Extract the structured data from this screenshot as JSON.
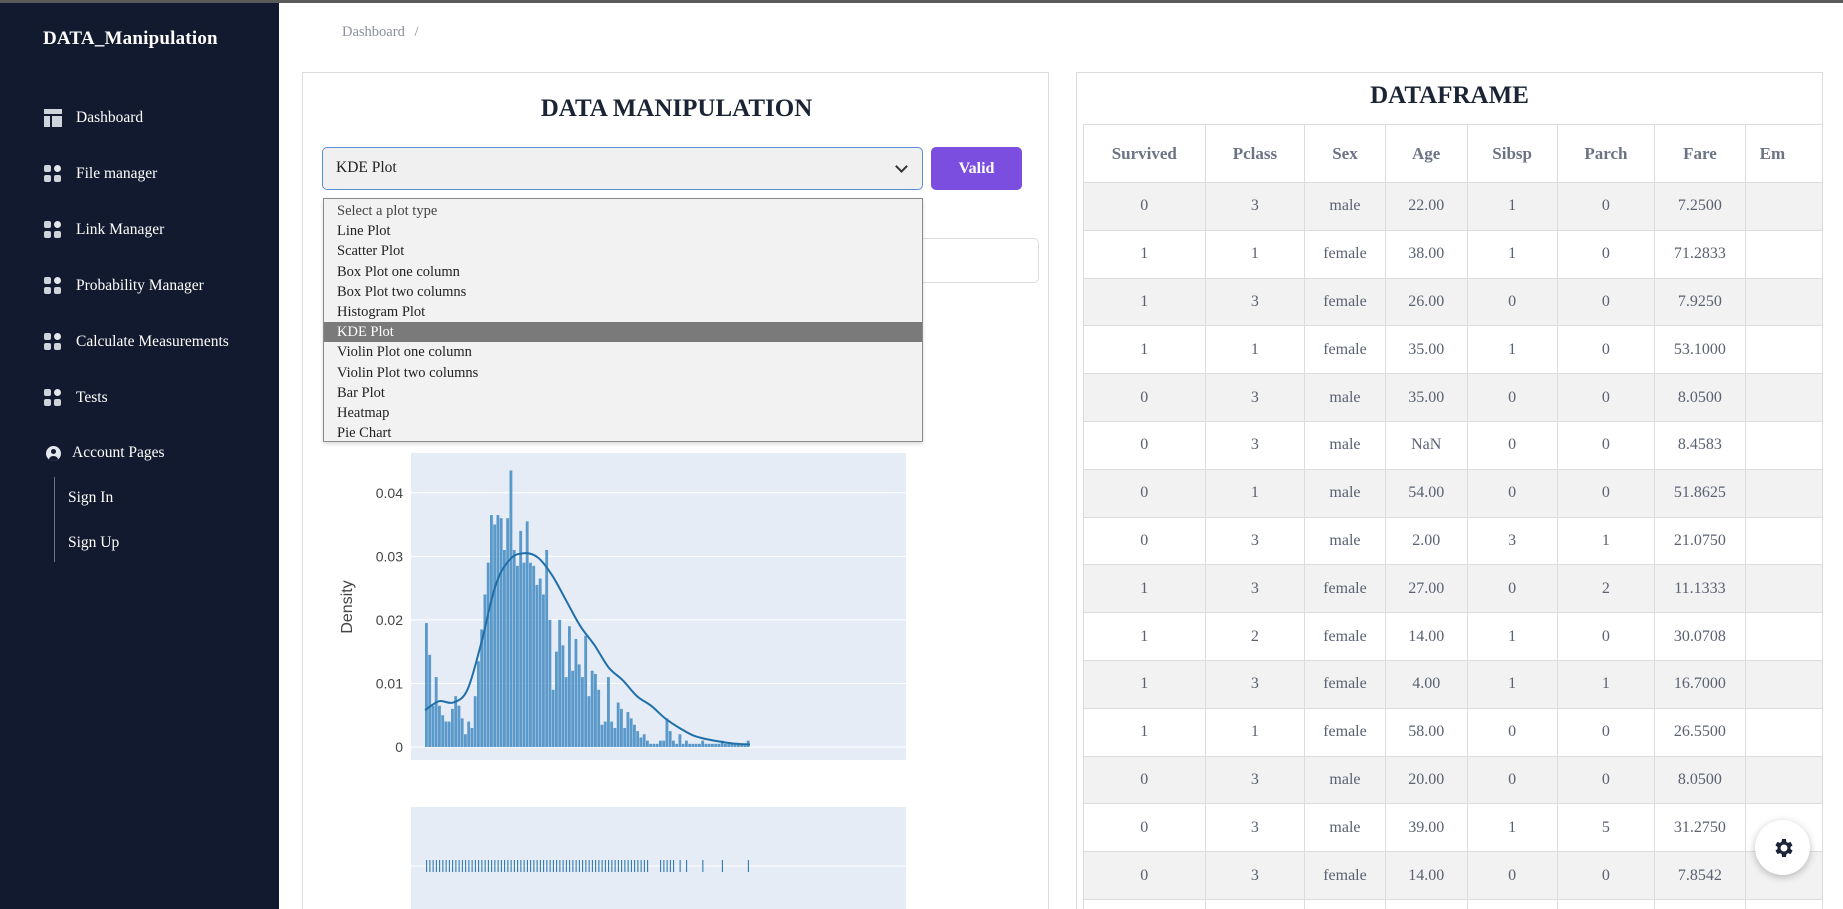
{
  "sidebar": {
    "brand": "DATA_Manipulation",
    "items": [
      {
        "label": "Dashboard",
        "icon": "dashboard-icon"
      },
      {
        "label": "File manager",
        "icon": "grid-icon"
      },
      {
        "label": "Link Manager",
        "icon": "grid-icon"
      },
      {
        "label": "Probability Manager",
        "icon": "grid-icon"
      },
      {
        "label": "Calculate Measurements",
        "icon": "grid-icon"
      },
      {
        "label": "Tests",
        "icon": "grid-icon"
      }
    ],
    "account": {
      "label": "Account Pages",
      "icon": "user-circle-icon",
      "sub": [
        "Sign In",
        "Sign Up"
      ]
    }
  },
  "breadcrumb": {
    "text": "Dashboard",
    "separator": "/"
  },
  "manipulation": {
    "title": "DATA MANIPULATION",
    "selected": "KDE Plot",
    "valid_label": "Valid",
    "options": [
      "Select a plot type",
      "Line Plot",
      "Scatter Plot",
      "Box Plot one column",
      "Box Plot two columns",
      "Histogram Plot",
      "KDE Plot",
      "Violin Plot one column",
      "Violin Plot two columns",
      "Bar Plot",
      "Heatmap",
      "Pie Chart"
    ]
  },
  "chart_data": {
    "type": "bar",
    "ylabel": "Density",
    "yticks": [
      "0",
      "0.01",
      "0.02",
      "0.03",
      "0.04"
    ],
    "ylim": [
      0,
      0.045
    ],
    "bar_color": "#4a90c4",
    "line_color": "#1f6fa8",
    "values": [
      0.0195,
      0.0145,
      0.0065,
      0.011,
      0.0065,
      0.005,
      0.004,
      0.004,
      0.006,
      0.008,
      0.0065,
      0.0045,
      0.002,
      0.004,
      0.003,
      0.008,
      0.0135,
      0.0185,
      0.024,
      0.029,
      0.0365,
      0.035,
      0.0365,
      0.036,
      0.031,
      0.036,
      0.0435,
      0.031,
      0.0285,
      0.034,
      0.029,
      0.0355,
      0.029,
      0.0285,
      0.0255,
      0.0265,
      0.024,
      0.031,
      0.02,
      0.009,
      0.015,
      0.02,
      0.016,
      0.011,
      0.019,
      0.012,
      0.017,
      0.013,
      0.011,
      0.0175,
      0.008,
      0.012,
      0.0115,
      0.009,
      0.0035,
      0.004,
      0.011,
      0.004,
      0.003,
      0.007,
      0.006,
      0.003,
      0.0055,
      0.0045,
      0.0035,
      0.0025,
      0.0015,
      0.002,
      0.001,
      0.0005,
      0.0005,
      0.0005,
      0.001,
      0.001,
      0.0045,
      0.0025,
      0.001,
      0.0005,
      0.002,
      0.0005,
      0.001,
      0.0005,
      0.0005,
      0.0005,
      0.0005,
      0.001,
      0.0005,
      0.0005,
      0.0005,
      0.0005,
      0.0005,
      0.001,
      0.0005,
      0.0005,
      0.0005,
      0.0005,
      0.0005,
      0.0005,
      0.0005,
      0.001
    ],
    "kde": [
      0.0058,
      0.0072,
      0.007,
      0.009,
      0.0165,
      0.0255,
      0.0295,
      0.0305,
      0.0298,
      0.027,
      0.023,
      0.019,
      0.016,
      0.0125,
      0.0105,
      0.008,
      0.0065,
      0.0045,
      0.003,
      0.0018,
      0.0012,
      0.0008,
      0.0005,
      0.0004
    ]
  },
  "dataframe": {
    "title": "DATAFRAME",
    "columns": [
      "Survived",
      "Pclass",
      "Sex",
      "Age",
      "Sibsp",
      "Parch",
      "Fare",
      "Em"
    ],
    "rows": [
      [
        "0",
        "3",
        "male",
        "22.00",
        "1",
        "0",
        "7.2500",
        ""
      ],
      [
        "1",
        "1",
        "female",
        "38.00",
        "1",
        "0",
        "71.2833",
        ""
      ],
      [
        "1",
        "3",
        "female",
        "26.00",
        "0",
        "0",
        "7.9250",
        ""
      ],
      [
        "1",
        "1",
        "female",
        "35.00",
        "1",
        "0",
        "53.1000",
        ""
      ],
      [
        "0",
        "3",
        "male",
        "35.00",
        "0",
        "0",
        "8.0500",
        ""
      ],
      [
        "0",
        "3",
        "male",
        "NaN",
        "0",
        "0",
        "8.4583",
        ""
      ],
      [
        "0",
        "1",
        "male",
        "54.00",
        "0",
        "0",
        "51.8625",
        ""
      ],
      [
        "0",
        "3",
        "male",
        "2.00",
        "3",
        "1",
        "21.0750",
        ""
      ],
      [
        "1",
        "3",
        "female",
        "27.00",
        "0",
        "2",
        "11.1333",
        ""
      ],
      [
        "1",
        "2",
        "female",
        "14.00",
        "1",
        "0",
        "30.0708",
        ""
      ],
      [
        "1",
        "3",
        "female",
        "4.00",
        "1",
        "1",
        "16.7000",
        ""
      ],
      [
        "1",
        "1",
        "female",
        "58.00",
        "0",
        "0",
        "26.5500",
        ""
      ],
      [
        "0",
        "3",
        "male",
        "20.00",
        "0",
        "0",
        "8.0500",
        ""
      ],
      [
        "0",
        "3",
        "male",
        "39.00",
        "1",
        "5",
        "31.2750",
        ""
      ],
      [
        "0",
        "3",
        "female",
        "14.00",
        "0",
        "0",
        "7.8542",
        ""
      ],
      [
        "",
        "",
        "",
        "",
        "",
        "",
        "",
        ""
      ]
    ]
  },
  "settings": {
    "icon": "gear-icon"
  }
}
